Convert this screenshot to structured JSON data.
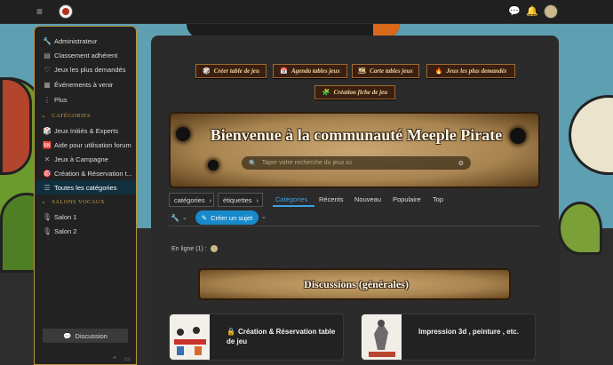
{
  "icons": {
    "menu": "≡",
    "chat": "💬",
    "bell": "🔔",
    "search": "🔍",
    "options": "⚙"
  },
  "sidebar": {
    "items": [
      {
        "icon": "🔧",
        "label": "Administrateur"
      },
      {
        "icon": "▤",
        "label": "Classement adhérent"
      },
      {
        "icon": "♡",
        "label": "Jeux les plus demandés"
      },
      {
        "icon": "▦",
        "label": "Événements à venir"
      },
      {
        "icon": "⋮",
        "label": "Plus"
      }
    ],
    "categories_heading": "CATÉGORIES",
    "categories": [
      {
        "icon": "🎲",
        "label": "Jeux Initiés & Experts",
        "active": false
      },
      {
        "icon": "🆘",
        "label": "Aide pour utilisation forum",
        "active": false
      },
      {
        "icon": "✕",
        "label": "Jeux à Campagne",
        "active": false
      },
      {
        "icon": "🎯",
        "label": "Création & Réservation t...",
        "active": false
      },
      {
        "icon": "☰",
        "label": "Toutes les catégories",
        "active": true
      }
    ],
    "voice_heading": "SALONS VOCAUX",
    "voice": [
      {
        "icon": "🎙",
        "label": "Salon 1"
      },
      {
        "icon": "🎙",
        "label": "Salon 2"
      }
    ],
    "discussion_button": "Discussion",
    "discussion_icon": "💬",
    "footer_plus": "+",
    "footer_icon": "▭"
  },
  "quick_buttons": [
    {
      "icon": "🎲",
      "label": "Créer table de jeu"
    },
    {
      "icon": "📅",
      "label": "Agenda tables jeux"
    },
    {
      "icon": "🗺",
      "label": "Carte tables jeux"
    },
    {
      "icon": "🔥",
      "label": "Jeux les plus demandés"
    },
    {
      "icon": "🧩",
      "label": "Création fiche de jeu"
    }
  ],
  "banner": {
    "title": "Bienvenue à la communauté Meeple Pirate",
    "search_placeholder": "Taper votre recherche du jeux ici"
  },
  "filters": {
    "categories_dropdown": "catégories",
    "tags_dropdown": "étiquettes",
    "caret": "›",
    "tabs": [
      "Catégories",
      "Récents",
      "Nouveau",
      "Populaire",
      "Top"
    ]
  },
  "actions": {
    "tool_icon": "🔧",
    "create_topic": "Créer un sujet",
    "create_icon": "✎",
    "caret_down": "⌄"
  },
  "online": {
    "label": "En ligne (1) :"
  },
  "section": {
    "title": "Discussions (générales)"
  },
  "cards": [
    {
      "locked": true,
      "lock_icon": "🔒",
      "title": "Création & Réservation table de jeu"
    },
    {
      "locked": false,
      "lock_icon": "",
      "title": "Impression 3d , peinture , etc."
    }
  ]
}
